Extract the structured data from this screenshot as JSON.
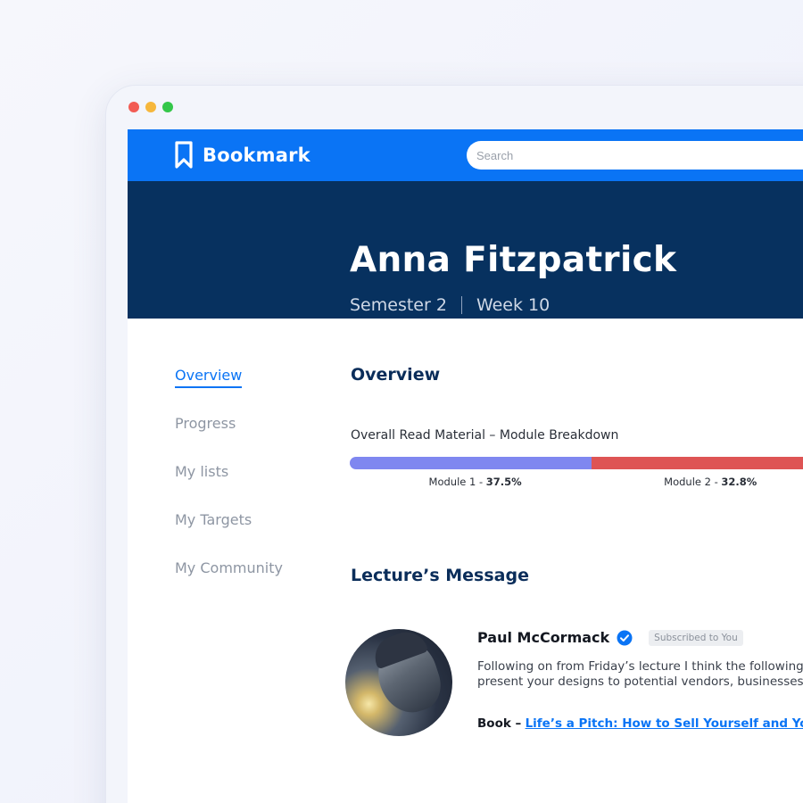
{
  "colors": {
    "topbar": "#0a74f5",
    "hero": "#07315f",
    "accent": "#0a74f5",
    "module1": "#7f87f0",
    "module2": "#de5454",
    "heading": "#0a2d5a"
  },
  "topbar": {
    "logo_icon": "bookmark-icon",
    "logo_text": "Bookmark",
    "search_placeholder": "Search"
  },
  "hero": {
    "name": "Anna Fitzpatrick",
    "semester": "Semester 2",
    "week": "Week 10"
  },
  "sidebar": {
    "items": [
      {
        "label": "Overview",
        "active": true
      },
      {
        "label": "Progress",
        "active": false
      },
      {
        "label": "My lists",
        "active": false
      },
      {
        "label": "My Targets",
        "active": false
      },
      {
        "label": "My Community",
        "active": false
      }
    ]
  },
  "overview": {
    "title": "Overview",
    "caption": "Overall Read Material – Module Breakdown"
  },
  "chart_data": {
    "type": "bar",
    "title": "Overall Read Material – Module Breakdown",
    "orientation": "stacked-horizontal",
    "categories": [
      "Module 1",
      "Module 2"
    ],
    "values": [
      37.5,
      32.8
    ],
    "unit": "%",
    "series": [
      {
        "name": "Module 1",
        "value": 37.5,
        "label_prefix": "Module 1 - ",
        "label_value": "37.5%",
        "color": "#7f87f0"
      },
      {
        "name": "Module 2",
        "value": 32.8,
        "label_prefix": "Module 2 - ",
        "label_value": "32.8%",
        "color": "#de5454"
      }
    ]
  },
  "lecture": {
    "title": "Lecture’s Message",
    "poster_name": "Paul McCormack",
    "verified_icon": "verified-check-icon",
    "badge": "Subscribed to You",
    "message_line1": "Following on from Friday’s lecture I think the following",
    "message_line2": "present your designs to potential vendors, businesses a",
    "book_prefix": "Book –",
    "book_link": "Life’s a Pitch: How to Sell Yourself and Your Br"
  },
  "window": {
    "controls": [
      "close",
      "minimize",
      "maximize"
    ]
  }
}
